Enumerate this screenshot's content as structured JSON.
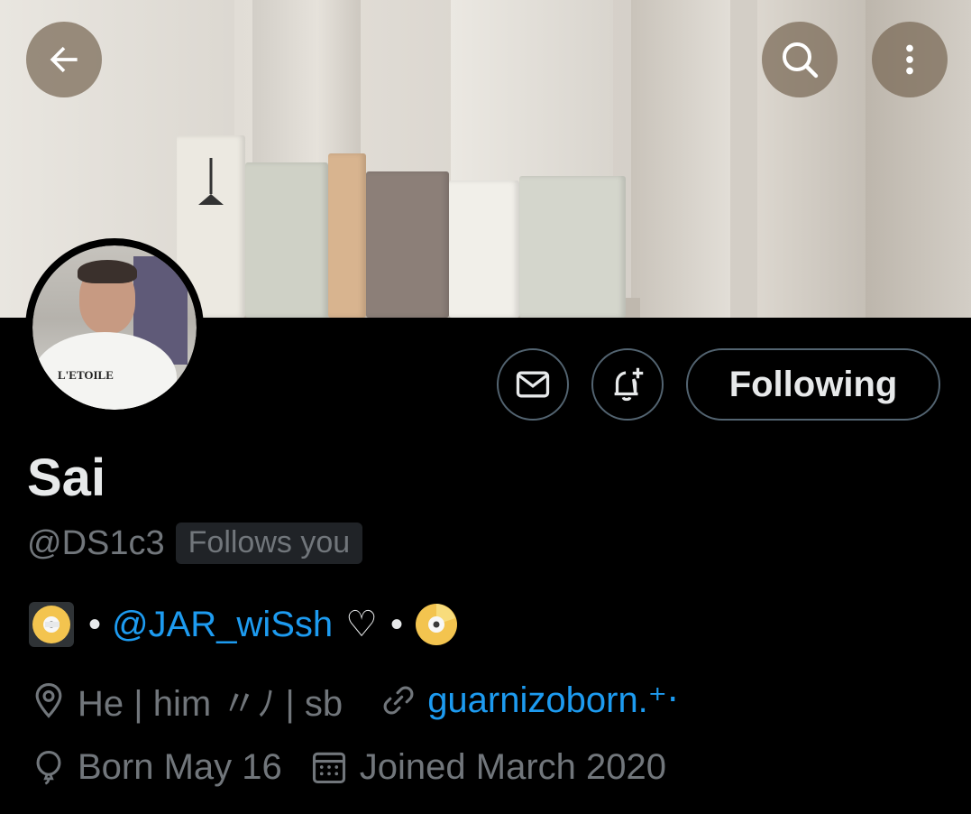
{
  "header": {
    "back_icon": "arrow-left-icon",
    "search_icon": "search-icon",
    "more_icon": "more-vertical-icon"
  },
  "profile": {
    "name": "Sai",
    "handle": "@DS1c3",
    "follows_you": "Follows you",
    "bio": {
      "separator": "•",
      "mention": "@JAR_wiSsh",
      "heart": "♡",
      "emoji_name": "dvd-emoji"
    },
    "location_text": "He | him 〃ﾉ | sb",
    "website": "guarnizoborn.⁺‧",
    "birthday": "Born May 16",
    "joined": "Joined March 2020"
  },
  "actions": {
    "message_icon": "mail-icon",
    "notify_icon": "bell-plus-icon",
    "following_label": "Following"
  },
  "colors": {
    "background": "#000000",
    "text_primary": "#e7e9ea",
    "text_secondary": "#71767b",
    "accent": "#1d9bf0",
    "border": "#536471"
  }
}
